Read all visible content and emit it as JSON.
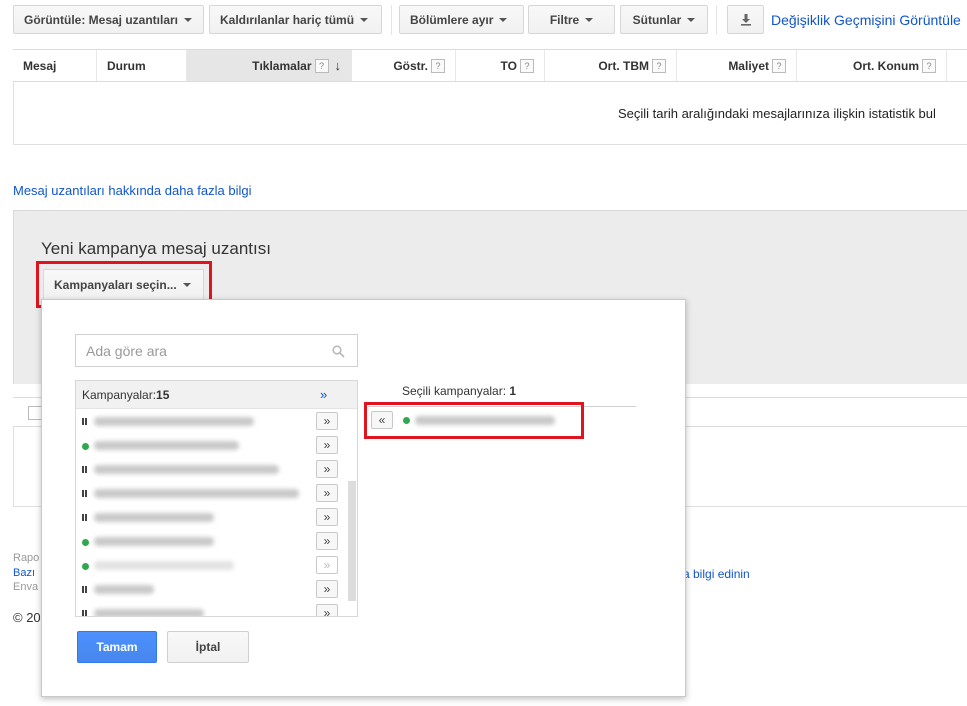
{
  "toolbar": {
    "view_label": "Görüntüle: Mesaj uzantıları",
    "removed_label": "Kaldırılanlar hariç tümü",
    "segments_label": "Bölümlere ayır",
    "filter_label": "Filtre",
    "columns_label": "Sütunlar",
    "history_label": "Değişiklik Geçmişini Görüntüle"
  },
  "table": {
    "columns": [
      "Mesaj",
      "Durum",
      "Tıklamalar",
      "Göstr.",
      "TO",
      "Ort. TBM",
      "Maliyet",
      "Ort. Konum"
    ],
    "help_glyph": "?",
    "sort_glyph": "↓",
    "empty_message": "Seçili tarih aralığındaki mesajlarınıza ilişkin istatistik bul"
  },
  "learn_more": "Mesaj uzantıları hakkında daha fazla bilgi",
  "new_ext": {
    "title": "Yeni kampanya mesaj uzantısı",
    "select_button": "Kampanyaları seçin..."
  },
  "picker": {
    "search_placeholder": "Ada göre ara",
    "campaigns_label": "Kampanyalar: ",
    "campaigns_count": "15",
    "add_all_glyph": "»",
    "add_glyph": "»",
    "remove_glyph": "«",
    "selected_label": "Seçili kampanyalar: ",
    "selected_count": "1",
    "ok_label": "Tamam",
    "cancel_label": "İptal",
    "items": [
      {
        "status": "paused"
      },
      {
        "status": "active"
      },
      {
        "status": "paused"
      },
      {
        "status": "paused"
      },
      {
        "status": "paused"
      },
      {
        "status": "active"
      },
      {
        "status": "active",
        "disabled": true
      },
      {
        "status": "paused"
      },
      {
        "status": "paused"
      }
    ]
  },
  "footer": {
    "line1": "Rapo",
    "line2": "Bazı",
    "line3": "Enva",
    "link_tail": "a bilgi edinin",
    "copyright": "© 20"
  },
  "colors": {
    "link": "#1155cc",
    "ok_button": "#4d90fe",
    "highlight": "#e0141e",
    "active_dot": "#2fa84f"
  }
}
